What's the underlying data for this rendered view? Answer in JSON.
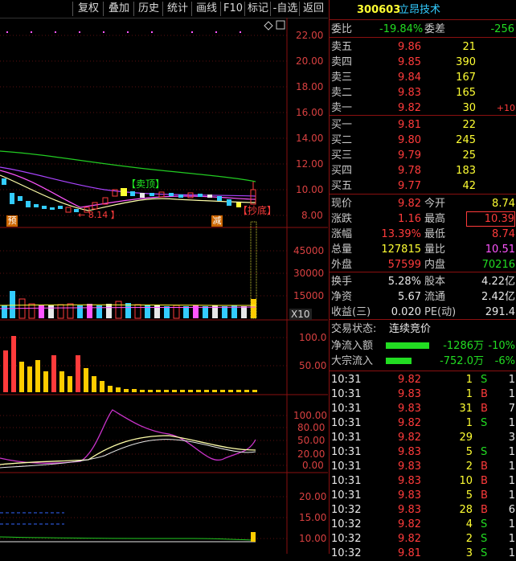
{
  "toolbar": {
    "buttons": [
      "复权",
      "叠加",
      "历史",
      "统计",
      "画线",
      "F10",
      "标记",
      "-自选",
      "返回"
    ]
  },
  "stock": {
    "code": "300603",
    "name": "立昂技术"
  },
  "price_axis": [
    "22.00",
    "20.00",
    "18.00",
    "16.00",
    "14.00",
    "12.00",
    "10.00",
    "8.00"
  ],
  "volume_axis": [
    "45000",
    "30000",
    "15000"
  ],
  "volume_scale": "X10",
  "indicator1_axis": [
    "100.0",
    "50.00"
  ],
  "indicator2_axis": [
    "100.00",
    "80.00",
    "50.00",
    "20.00",
    "0.00"
  ],
  "indicator3_axis": [
    "20.00",
    "15.00",
    "10.00"
  ],
  "annotations": {
    "sell_top": "【卖顶】",
    "low_price": "← 8.14 】",
    "buy_bottom": "【抄底】",
    "left_badge": "预",
    "right_badge": "减"
  },
  "quote": {
    "weibi_label": "委比",
    "weibi": "-19.84%",
    "weicha_label": "委差",
    "weicha": "-256",
    "asks": [
      {
        "label": "卖五",
        "price": "9.86",
        "vol": "21",
        "chg": ""
      },
      {
        "label": "卖四",
        "price": "9.85",
        "vol": "390",
        "chg": ""
      },
      {
        "label": "卖三",
        "price": "9.84",
        "vol": "167",
        "chg": ""
      },
      {
        "label": "卖二",
        "price": "9.83",
        "vol": "165",
        "chg": ""
      },
      {
        "label": "卖一",
        "price": "9.82",
        "vol": "30",
        "chg": "+10"
      }
    ],
    "bids": [
      {
        "label": "买一",
        "price": "9.81",
        "vol": "22"
      },
      {
        "label": "买二",
        "price": "9.80",
        "vol": "245"
      },
      {
        "label": "买三",
        "price": "9.79",
        "vol": "25"
      },
      {
        "label": "买四",
        "price": "9.78",
        "vol": "183"
      },
      {
        "label": "买五",
        "price": "9.77",
        "vol": "42"
      }
    ],
    "stats": [
      {
        "l1": "现价",
        "v1": "9.82",
        "l2": "今开",
        "v2": "8.74"
      },
      {
        "l1": "涨跌",
        "v1": "1.16",
        "l2": "最高",
        "v2": "10.39"
      },
      {
        "l1": "涨幅",
        "v1": "13.39%",
        "l2": "最低",
        "v2": "8.74"
      },
      {
        "l1": "总量",
        "v1": "127815",
        "l2": "量比",
        "v2": "10.51"
      },
      {
        "l1": "外盘",
        "v1": "57599",
        "l2": "内盘",
        "v2": "70216"
      }
    ],
    "stats2": [
      {
        "l1": "换手",
        "v1": "5.28%",
        "l2": "股本",
        "v2": "4.22亿"
      },
      {
        "l1": "净资",
        "v1": "5.67",
        "l2": "流通",
        "v2": "2.42亿"
      },
      {
        "l1": "收益(三)",
        "v1": "0.020",
        "l2": "PE(动)",
        "v2": "291.4"
      }
    ],
    "trade_status_label": "交易状态:",
    "trade_status": "连续竞价",
    "net_inflow_label": "净流入额",
    "net_inflow": "-1286万",
    "net_inflow_pct": "-10%",
    "block_inflow_label": "大宗流入",
    "block_inflow": "-752.0万",
    "block_inflow_pct": "-6%"
  },
  "ticks": [
    {
      "time": "10:31",
      "price": "9.82",
      "vol": "1",
      "side": "S",
      "n": "1"
    },
    {
      "time": "10:31",
      "price": "9.83",
      "vol": "1",
      "side": "B",
      "n": "1"
    },
    {
      "time": "10:31",
      "price": "9.83",
      "vol": "31",
      "side": "B",
      "n": "7"
    },
    {
      "time": "10:31",
      "price": "9.82",
      "vol": "1",
      "side": "S",
      "n": "1"
    },
    {
      "time": "10:31",
      "price": "9.82",
      "vol": "29",
      "side": "",
      "n": "3"
    },
    {
      "time": "10:31",
      "price": "9.83",
      "vol": "5",
      "side": "S",
      "n": "1"
    },
    {
      "time": "10:31",
      "price": "9.83",
      "vol": "2",
      "side": "B",
      "n": "1"
    },
    {
      "time": "10:31",
      "price": "9.83",
      "vol": "10",
      "side": "B",
      "n": "1"
    },
    {
      "time": "10:31",
      "price": "9.83",
      "vol": "5",
      "side": "B",
      "n": "1"
    },
    {
      "time": "10:32",
      "price": "9.83",
      "vol": "28",
      "side": "B",
      "n": "6"
    },
    {
      "time": "10:32",
      "price": "9.82",
      "vol": "4",
      "side": "S",
      "n": "1"
    },
    {
      "time": "10:32",
      "price": "9.82",
      "vol": "2",
      "side": "S",
      "n": "1"
    },
    {
      "time": "10:32",
      "price": "9.81",
      "vol": "3",
      "side": "S",
      "n": "1"
    }
  ]
}
